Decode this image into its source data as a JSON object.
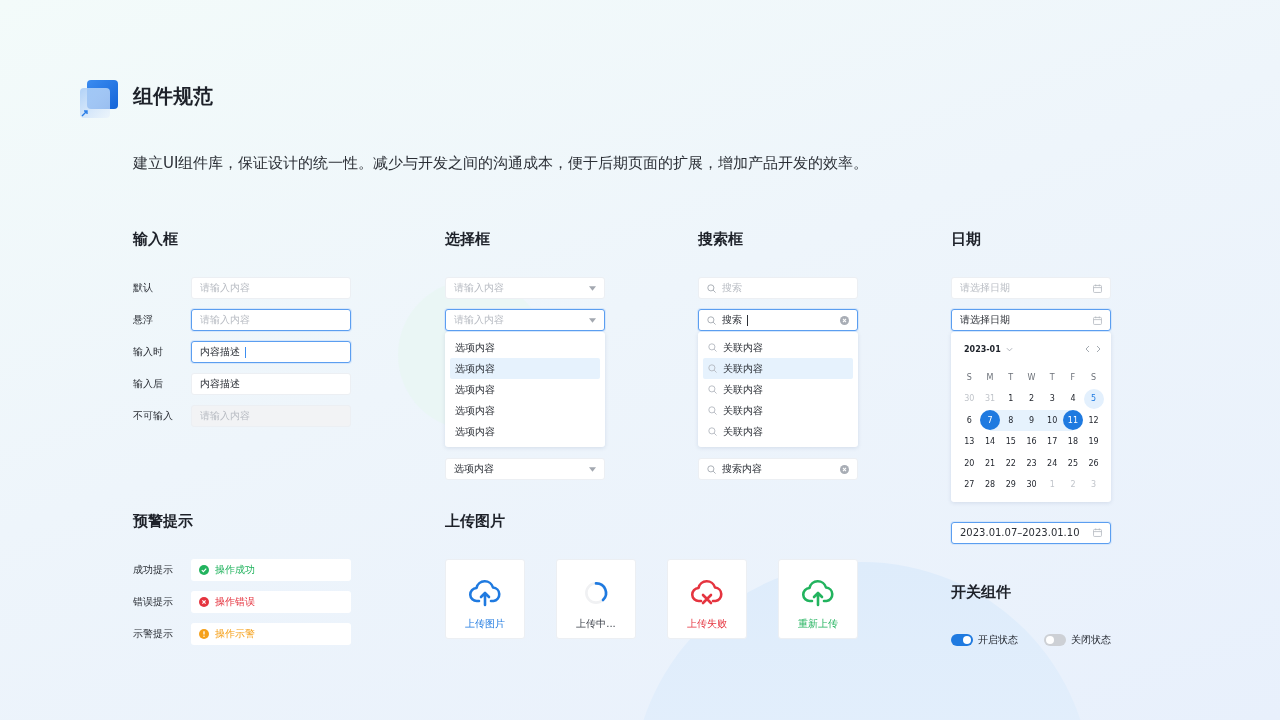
{
  "header": {
    "title": "组件规范",
    "description": "建立UI组件库，保证设计的统一性。减少与开发之间的沟通成本，便于后期页面的扩展，增加产品开发的效率。"
  },
  "inputs": {
    "title": "输入框",
    "rows": [
      {
        "label": "默认",
        "kind": "default",
        "placeholder": "请输入内容"
      },
      {
        "label": "悬浮",
        "kind": "hover",
        "placeholder": "请输入内容"
      },
      {
        "label": "输入时",
        "kind": "focus",
        "value": "内容描述"
      },
      {
        "label": "输入后",
        "kind": "filled",
        "value": "内容描述"
      },
      {
        "label": "不可输入",
        "kind": "disabled",
        "placeholder": "请输入内容"
      }
    ]
  },
  "selects": {
    "title": "选择框",
    "items": [
      {
        "placeholder": "请输入内容",
        "expanded": false
      },
      {
        "placeholder": "请输入内容",
        "expanded": true,
        "options": [
          {
            "label": "选项内容",
            "selected": false
          },
          {
            "label": "选项内容",
            "selected": true
          },
          {
            "label": "选项内容",
            "selected": false
          },
          {
            "label": "选项内容",
            "selected": false
          },
          {
            "label": "选项内容",
            "selected": false
          }
        ]
      },
      {
        "value": "选项内容",
        "expanded": false
      }
    ]
  },
  "searches": {
    "title": "搜索框",
    "items": [
      {
        "placeholder": "搜索",
        "focused": false
      },
      {
        "value": "搜索",
        "focused": true,
        "suggestions": [
          {
            "label": "关联内容",
            "selected": false
          },
          {
            "label": "关联内容",
            "selected": true
          },
          {
            "label": "关联内容",
            "selected": false
          },
          {
            "label": "关联内容",
            "selected": false
          },
          {
            "label": "关联内容",
            "selected": false
          }
        ]
      },
      {
        "value": "搜索内容",
        "focused": false
      }
    ]
  },
  "dates": {
    "title": "日期",
    "items": [
      {
        "placeholder": "请选择日期",
        "focused": false
      },
      {
        "value": "请选择日期",
        "focused": true,
        "calendar": {
          "month": "2023-01",
          "weekdays": [
            "S",
            "M",
            "T",
            "W",
            "T",
            "F",
            "S"
          ],
          "weeks": [
            [
              {
                "day": "30",
                "kind": "other"
              },
              {
                "day": "31",
                "kind": "other"
              },
              {
                "day": "1",
                "kind": "normal"
              },
              {
                "day": "2",
                "kind": "normal"
              },
              {
                "day": "3",
                "kind": "normal"
              },
              {
                "day": "4",
                "kind": "normal"
              },
              {
                "day": "5",
                "kind": "today"
              }
            ],
            [
              {
                "day": "6",
                "kind": "normal"
              },
              {
                "day": "7",
                "kind": "start"
              },
              {
                "day": "8",
                "kind": "range"
              },
              {
                "day": "9",
                "kind": "range"
              },
              {
                "day": "10",
                "kind": "range"
              },
              {
                "day": "11",
                "kind": "end"
              },
              {
                "day": "12",
                "kind": "normal"
              }
            ],
            [
              {
                "day": "13",
                "kind": "normal"
              },
              {
                "day": "14",
                "kind": "normal"
              },
              {
                "day": "15",
                "kind": "normal"
              },
              {
                "day": "16",
                "kind": "normal"
              },
              {
                "day": "17",
                "kind": "normal"
              },
              {
                "day": "18",
                "kind": "normal"
              },
              {
                "day": "19",
                "kind": "normal"
              }
            ],
            [
              {
                "day": "20",
                "kind": "normal"
              },
              {
                "day": "21",
                "kind": "normal"
              },
              {
                "day": "22",
                "kind": "normal"
              },
              {
                "day": "23",
                "kind": "normal"
              },
              {
                "day": "24",
                "kind": "normal"
              },
              {
                "day": "25",
                "kind": "normal"
              },
              {
                "day": "26",
                "kind": "normal"
              }
            ],
            [
              {
                "day": "27",
                "kind": "normal"
              },
              {
                "day": "28",
                "kind": "normal"
              },
              {
                "day": "29",
                "kind": "normal"
              },
              {
                "day": "30",
                "kind": "normal"
              },
              {
                "day": "1",
                "kind": "other"
              },
              {
                "day": "2",
                "kind": "other"
              },
              {
                "day": "3",
                "kind": "other"
              }
            ]
          ]
        }
      },
      {
        "value": "2023.01.07–2023.01.10",
        "focused": true
      }
    ]
  },
  "alerts": {
    "title": "预警提示",
    "rows": [
      {
        "label": "成功提示",
        "kind": "success",
        "message": "操作成功"
      },
      {
        "label": "错误提示",
        "kind": "error",
        "message": "操作错误"
      },
      {
        "label": "示警提示",
        "kind": "warning",
        "message": "操作示警"
      }
    ]
  },
  "uploads": {
    "title": "上传图片",
    "items": [
      {
        "kind": "upload",
        "label": "上传图片"
      },
      {
        "kind": "loading",
        "label": "上传中..."
      },
      {
        "kind": "failed",
        "label": "上传失败"
      },
      {
        "kind": "retry",
        "label": "重新上传"
      }
    ]
  },
  "switches": {
    "title": "开关组件",
    "items": [
      {
        "label": "开启状态",
        "on": true
      },
      {
        "label": "关闭状态",
        "on": false
      }
    ]
  }
}
